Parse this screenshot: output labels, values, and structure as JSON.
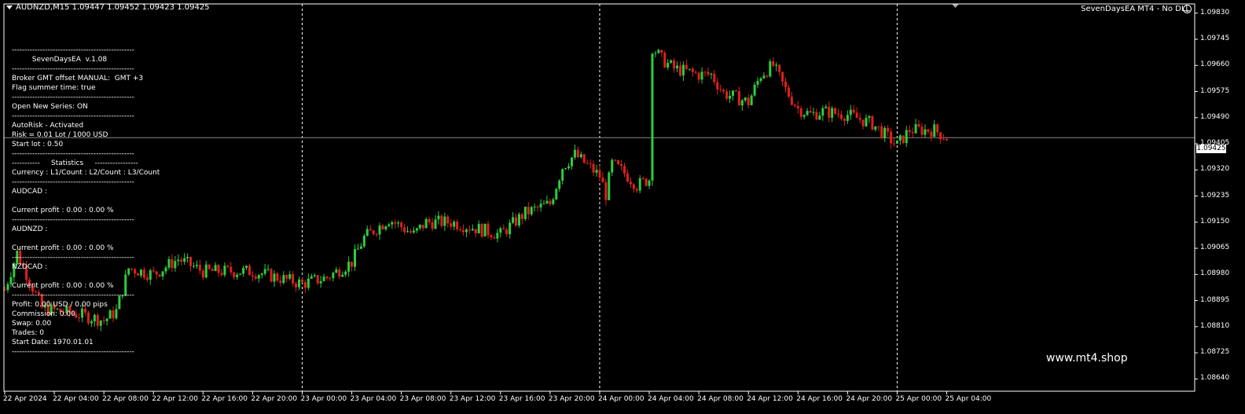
{
  "header": {
    "symbol_info": "AUDNZD,M15  1.09447 1.09452 1.09423 1.09425",
    "ea_status": "SevenDaysEA MT4 - No DLL"
  },
  "panel": {
    "lines": [
      "------------------------------------------------",
      "         SevenDaysEA  v.1.08",
      "------------------------------------------------",
      "Broker GMT offset MANUAL:  GMT +3",
      "Flag summer time: true",
      "------------------------------------------------",
      "Open New Series: ON",
      "------------------------------------------------",
      "AutoRisk - Activated",
      "Risk = 0.01 Lot / 1000 USD",
      "Start lot : 0.50",
      "------------------------------------------------",
      "-----------     Statistics     -----------------",
      "Currency : L1/Count : L2/Count : L3/Count",
      "------------------------------------------------",
      "AUDCAD :",
      "",
      "Current profit : 0.00 : 0.00 %",
      "------------------------------------------------",
      "AUDNZD :",
      "",
      "Current profit : 0.00 : 0.00 %",
      "------------------------------------------------",
      "NZDCAD :",
      "",
      "Current profit : 0.00 : 0.00 %",
      "------------------------------------------------",
      "Profit: 0.00 USD / 0.00 pips",
      "Commission: 0.00",
      "Swap: 0.00",
      "Trades: 0",
      "Start Date: 1970.01.01",
      "------------------------------------------------"
    ]
  },
  "watermark": "www.mt4.shop",
  "current_price_label": "1.09425",
  "colors": {
    "bull": "#2ecc40",
    "bear": "#e0201a",
    "background": "#000000",
    "axis": "#ffffff"
  },
  "chart_data": {
    "type": "candlestick",
    "symbol": "AUDNZD",
    "timeframe": "M15",
    "ylim": [
      1.086,
      1.0986
    ],
    "current_price": 1.09425,
    "y_ticks": [
      "1.09830",
      "1.09745",
      "1.09660",
      "1.09575",
      "1.09490",
      "1.09405",
      "1.09320",
      "1.09235",
      "1.09150",
      "1.09065",
      "1.08980",
      "1.08895",
      "1.08810",
      "1.08725",
      "1.08640"
    ],
    "x_ticks": [
      "22 Apr 2024",
      "22 Apr 04:00",
      "22 Apr 08:00",
      "22 Apr 12:00",
      "22 Apr 16:00",
      "22 Apr 20:00",
      "23 Apr 00:00",
      "23 Apr 04:00",
      "23 Apr 08:00",
      "23 Apr 12:00",
      "23 Apr 16:00",
      "23 Apr 20:00",
      "24 Apr 00:00",
      "24 Apr 04:00",
      "24 Apr 08:00",
      "24 Apr 12:00",
      "24 Apr 16:00",
      "24 Apr 20:00",
      "25 Apr 00:00",
      "25 Apr 04:00"
    ],
    "day_separators": [
      "23 Apr 00:00",
      "24 Apr 00:00",
      "25 Apr 00:00"
    ],
    "key_points": [
      {
        "t": "22 Apr 00:00",
        "price": 1.0893
      },
      {
        "t": "22 Apr 01:00",
        "price": 1.0905
      },
      {
        "t": "22 Apr 03:00",
        "price": 1.0887
      },
      {
        "t": "22 Apr 06:00",
        "price": 1.0885
      },
      {
        "t": "22 Apr 08:00",
        "price": 1.0883
      },
      {
        "t": "22 Apr 09:00",
        "price": 1.0886
      },
      {
        "t": "22 Apr 10:00",
        "price": 1.09
      },
      {
        "t": "22 Apr 12:00",
        "price": 1.0898
      },
      {
        "t": "22 Apr 14:00",
        "price": 1.0903
      },
      {
        "t": "22 Apr 16:00",
        "price": 1.0899
      },
      {
        "t": "22 Apr 20:00",
        "price": 1.0899
      },
      {
        "t": "23 Apr 00:00",
        "price": 1.0895
      },
      {
        "t": "23 Apr 02:00",
        "price": 1.0897
      },
      {
        "t": "23 Apr 04:00",
        "price": 1.0902
      },
      {
        "t": "23 Apr 05:00",
        "price": 1.091
      },
      {
        "t": "23 Apr 07:00",
        "price": 1.0916
      },
      {
        "t": "23 Apr 09:00",
        "price": 1.0911
      },
      {
        "t": "23 Apr 10:00",
        "price": 1.0915
      },
      {
        "t": "23 Apr 12:00",
        "price": 1.0915
      },
      {
        "t": "23 Apr 16:00",
        "price": 1.0911
      },
      {
        "t": "23 Apr 18:00",
        "price": 1.0918
      },
      {
        "t": "23 Apr 20:00",
        "price": 1.0921
      },
      {
        "t": "23 Apr 21:00",
        "price": 1.0933
      },
      {
        "t": "23 Apr 22:00",
        "price": 1.0937
      },
      {
        "t": "24 Apr 00:00",
        "price": 1.093
      },
      {
        "t": "24 Apr 00:30",
        "price": 1.0924
      },
      {
        "t": "24 Apr 01:00",
        "price": 1.0934
      },
      {
        "t": "24 Apr 02:00",
        "price": 1.0931
      },
      {
        "t": "24 Apr 03:00",
        "price": 1.0927
      },
      {
        "t": "24 Apr 04:00",
        "price": 1.0929
      },
      {
        "t": "24 Apr 04:15",
        "price": 1.0972
      },
      {
        "t": "24 Apr 05:00",
        "price": 1.0968
      },
      {
        "t": "24 Apr 06:00",
        "price": 1.0965
      },
      {
        "t": "24 Apr 08:00",
        "price": 1.0963
      },
      {
        "t": "24 Apr 09:00",
        "price": 1.0963
      },
      {
        "t": "24 Apr 10:00",
        "price": 1.0957
      },
      {
        "t": "24 Apr 12:00",
        "price": 1.0954
      },
      {
        "t": "24 Apr 13:00",
        "price": 1.0963
      },
      {
        "t": "24 Apr 14:00",
        "price": 1.0966
      },
      {
        "t": "24 Apr 15:00",
        "price": 1.0958
      },
      {
        "t": "24 Apr 16:00",
        "price": 1.0952
      },
      {
        "t": "24 Apr 17:00",
        "price": 1.095
      },
      {
        "t": "24 Apr 18:00",
        "price": 1.0951
      },
      {
        "t": "24 Apr 20:00",
        "price": 1.095
      },
      {
        "t": "24 Apr 22:00",
        "price": 1.0947
      },
      {
        "t": "25 Apr 00:00",
        "price": 1.094
      },
      {
        "t": "25 Apr 01:00",
        "price": 1.0945
      },
      {
        "t": "25 Apr 03:00",
        "price": 1.0945
      },
      {
        "t": "25 Apr 04:00",
        "price": 1.09425
      }
    ]
  }
}
